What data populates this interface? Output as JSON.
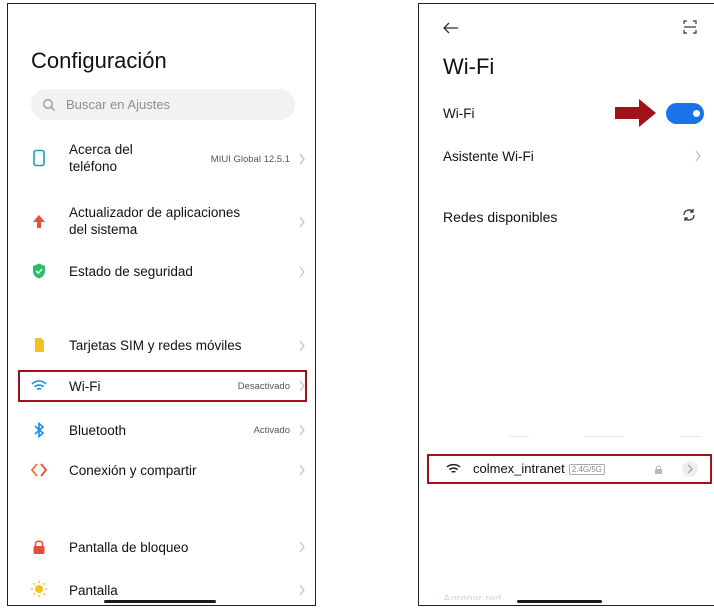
{
  "left": {
    "title": "Configuración",
    "search_placeholder": "Buscar en Ajustes",
    "items": [
      {
        "label_line1": "Acerca del",
        "label_line2": "teléfono",
        "value": "MIUI Global 12.5.1"
      },
      {
        "label_line1": "Actualizador de aplicaciones",
        "label_line2": "del sistema",
        "value": ""
      },
      {
        "label_line1": "Estado de seguridad",
        "label_line2": "",
        "value": ""
      },
      {
        "label_line1": "Tarjetas SIM y redes móviles",
        "label_line2": "",
        "value": ""
      },
      {
        "label_line1": "Wi-Fi",
        "label_line2": "",
        "value": "Desactivado"
      },
      {
        "label_line1": "Bluetooth",
        "label_line2": "",
        "value": "Activado"
      },
      {
        "label_line1": "Conexión y compartir",
        "label_line2": "",
        "value": ""
      },
      {
        "label_line1": "Pantalla de bloqueo",
        "label_line2": "",
        "value": ""
      },
      {
        "label_line1": "Pantalla",
        "label_line2": "",
        "value": ""
      }
    ]
  },
  "right": {
    "title": "Wi-Fi",
    "wifi_toggle_label": "Wi-Fi",
    "wifi_toggle_on": true,
    "assistant_label": "Asistente Wi-Fi",
    "available_label": "Redes disponibles",
    "network_name": "colmex_intranet",
    "network_badge": "2.4G/5G",
    "add_network_label": "Agregar red"
  },
  "colors": {
    "highlight": "#a0111a",
    "toggle": "#1a73e8",
    "arrow": "#a0111a"
  }
}
